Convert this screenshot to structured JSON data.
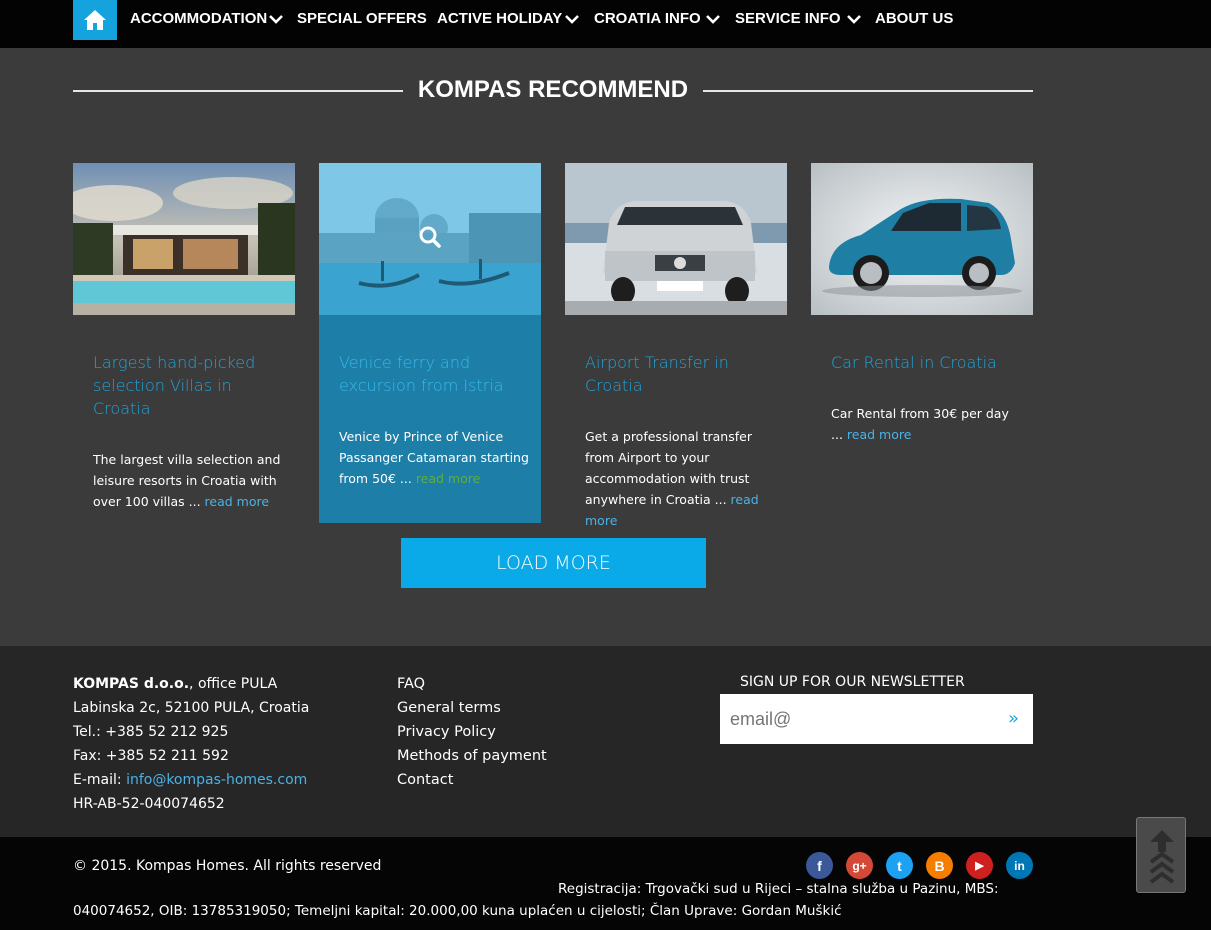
{
  "nav": {
    "items": [
      {
        "label": "ACCOMMODATION",
        "has_dropdown": true
      },
      {
        "label": "SPECIAL OFFERS",
        "has_dropdown": false
      },
      {
        "label": "ACTIVE HOLIDAY",
        "has_dropdown": true
      },
      {
        "label": "CROATIA INFO",
        "has_dropdown": true
      },
      {
        "label": "SERVICE INFO",
        "has_dropdown": true
      },
      {
        "label": "ABOUT US",
        "has_dropdown": false
      }
    ],
    "home_icon": "home-icon",
    "accent_color": "#14a3dc"
  },
  "section": {
    "heading": "KOMPAS RECOMMEND"
  },
  "cards": [
    {
      "title": "Largest hand-picked selection Villas in Croatia",
      "text": "The largest villa selection and leisure resorts in Croatia with over 100 villas ...",
      "more": "read more"
    },
    {
      "title": "Venice ferry and excursion from Istria",
      "text": "Venice by Prince of Venice Passanger Catamaran starting from 50€ ...",
      "more": "read more"
    },
    {
      "title": "Airport Transfer in Croatia",
      "text": "Get a professional transfer from Airport to your accommodation with trust anywhere in Croatia ...",
      "more": "read more"
    },
    {
      "title": "Car Rental in Croatia",
      "text": "Car Rental from 30€ per day ...",
      "more": "read more"
    }
  ],
  "load_more": "LOAD MORE",
  "footer": {
    "company_bold": "KOMPAS d.o.o.",
    "company_rest": ", office PULA",
    "address": "Labinska 2c, 52100 PULA, Croatia",
    "tel": "Tel.: +385 52 212 925",
    "fax": "Fax: +385 52 211 592",
    "email_label": "E-mail: ",
    "email": "info@kompas-homes.com",
    "reg_id": "HR-AB-52-040074652",
    "links": [
      "FAQ",
      "General terms",
      "Privacy Policy",
      "Methods of payment",
      "Contact"
    ],
    "newsletter_label": "SIGN UP FOR OUR NEWSLETTER",
    "newsletter_placeholder": "email@",
    "newsletter_go": "»"
  },
  "bottom": {
    "copyright": "© 2015. Kompas Homes. All rights reserved",
    "reg_line1": "Registracija: Trgovački sud u Rijeci – stalna služba u Pazinu, MBS:",
    "reg_line2": "040074652, OIB: 13785319050; Temeljni kapital: 20.000,00 kuna uplaćen u cijelosti; Član Uprave: Gordan Muškić",
    "social": [
      {
        "name": "facebook-icon",
        "glyph": "f",
        "color": "#3b5998"
      },
      {
        "name": "google-plus-icon",
        "glyph": "g+",
        "color": "#d34836"
      },
      {
        "name": "twitter-icon",
        "glyph": "t",
        "color": "#1da1f2"
      },
      {
        "name": "blogger-icon",
        "glyph": "B",
        "color": "#f57d00"
      },
      {
        "name": "youtube-icon",
        "glyph": "▶",
        "color": "#cd201f"
      },
      {
        "name": "linkedin-icon",
        "glyph": "in",
        "color": "#0077b5"
      }
    ]
  }
}
